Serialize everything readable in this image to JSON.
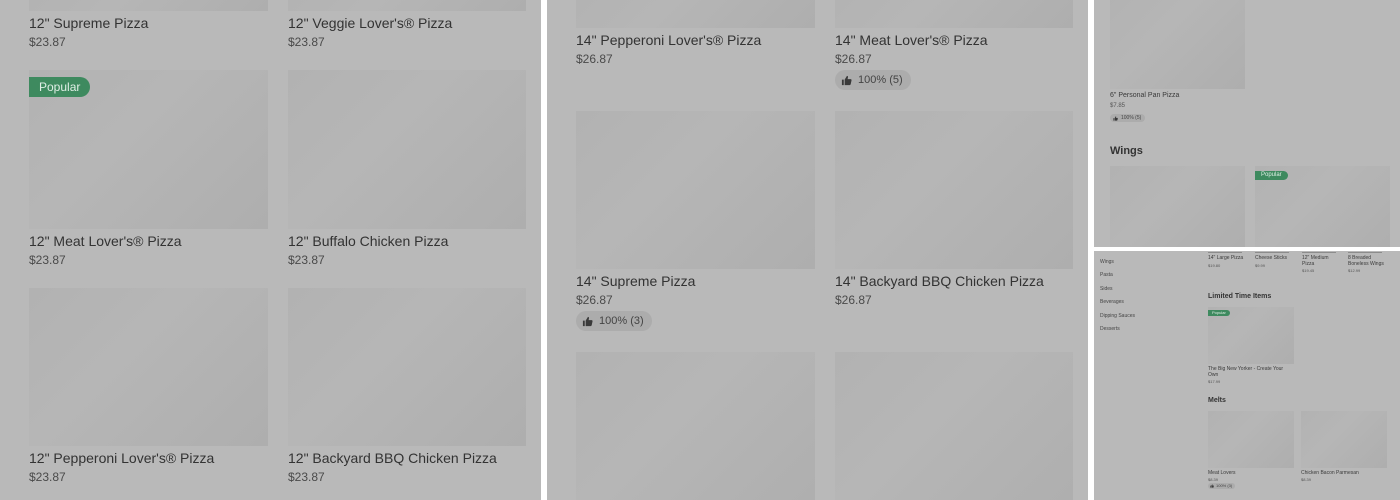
{
  "panel_a": {
    "items": [
      {
        "name": "12\" Supreme Pizza",
        "price": "$23.87"
      },
      {
        "name": "12\" Veggie Lover's® Pizza",
        "price": "$23.87"
      },
      {
        "name": "12\" Meat Lover's® Pizza",
        "price": "$23.87",
        "badge": "Popular"
      },
      {
        "name": "12\" Buffalo Chicken Pizza",
        "price": "$23.87"
      },
      {
        "name": "12\" Pepperoni Lover's® Pizza",
        "price": "$23.87"
      },
      {
        "name": "12\" Backyard BBQ Chicken Pizza",
        "price": "$23.87"
      }
    ]
  },
  "panel_b": {
    "items": [
      {
        "name": "14\" Pepperoni Lover's® Pizza",
        "price": "$26.87"
      },
      {
        "name": "14\" Meat Lover's® Pizza",
        "price": "$26.87",
        "rating": "100% (5)"
      },
      {
        "name": "14\" Supreme Pizza",
        "price": "$26.87",
        "rating": "100% (3)"
      },
      {
        "name": "14\" Backyard BBQ Chicken Pizza",
        "price": "$26.87"
      }
    ]
  },
  "panel_c": {
    "item": {
      "name": "6\" Personal Pan Pizza",
      "price": "$7.85",
      "rating": "100% (5)"
    },
    "section_title": "Wings",
    "badge": "Popular"
  },
  "panel_d": {
    "nav": [
      "Wings",
      "Pasta",
      "Sides",
      "Beverages",
      "Dipping Sauces",
      "Desserts"
    ],
    "top_items": [
      {
        "name": "14\" Large Pizza",
        "price": "$19.80"
      },
      {
        "name": "Cheese Sticks",
        "price": "$9.99"
      },
      {
        "name": "12\" Medium Pizza",
        "price": "$19.45"
      },
      {
        "name": "8 Breaded Boneless Wings",
        "price": "$12.99"
      }
    ],
    "limited": {
      "title": "Limited Time Items",
      "badge": "Popular",
      "item": {
        "name": "The Big New Yorker - Create Your Own",
        "price": "$17.99"
      }
    },
    "melts": {
      "title": "Melts",
      "items": [
        {
          "name": "Meat Lovers",
          "price": "$8.39",
          "rating": "100% (3)"
        },
        {
          "name": "Chicken Bacon Parmesan",
          "price": "$8.39"
        }
      ]
    }
  },
  "icons": {
    "rating": "thumbs-up-icon"
  },
  "colors": {
    "overlay": "#b9b9b9",
    "badge": "#3e8a5f",
    "divider": "#ffffff"
  }
}
